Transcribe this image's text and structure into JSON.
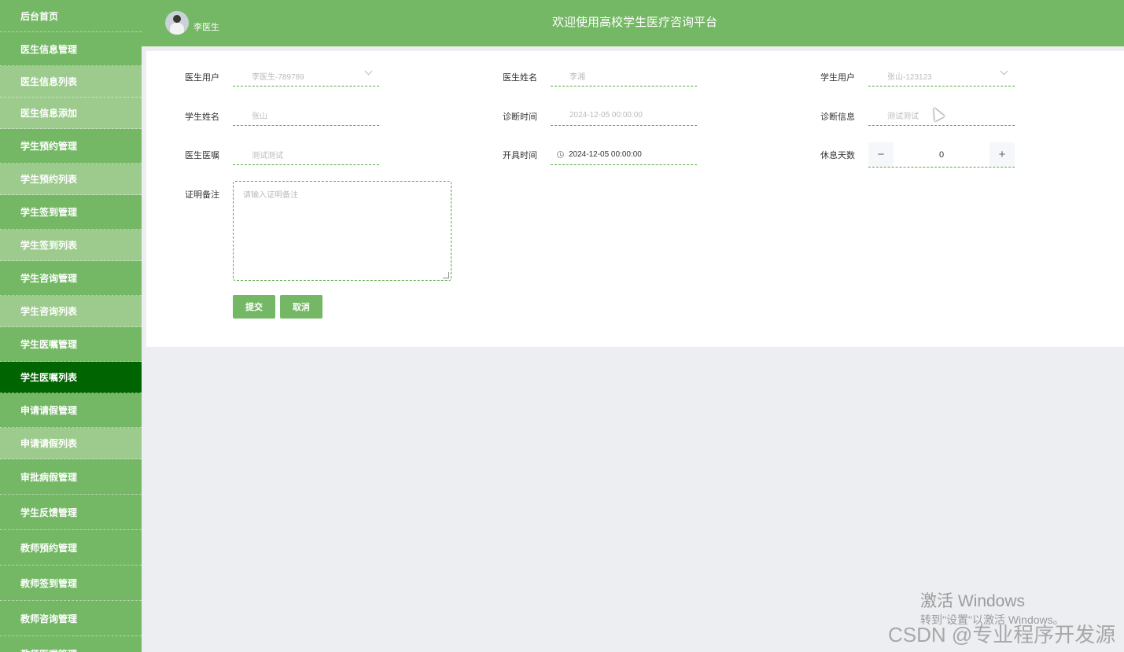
{
  "header": {
    "user_name": "李医生",
    "site_title": "欢迎使用高校学生医疗咨询平台"
  },
  "sidebar": {
    "items": [
      {
        "label": "后台首页",
        "type": "group"
      },
      {
        "label": "医生信息管理",
        "type": "group"
      },
      {
        "label": "医生信息列表",
        "type": "sub"
      },
      {
        "label": "医生信息添加",
        "type": "sub"
      },
      {
        "label": "学生预约管理",
        "type": "group"
      },
      {
        "label": "学生预约列表",
        "type": "sub"
      },
      {
        "label": "学生签到管理",
        "type": "group"
      },
      {
        "label": "学生签到列表",
        "type": "sub"
      },
      {
        "label": "学生咨询管理",
        "type": "group"
      },
      {
        "label": "学生咨询列表",
        "type": "sub"
      },
      {
        "label": "学生医嘱管理",
        "type": "group"
      },
      {
        "label": "学生医嘱列表",
        "type": "active"
      },
      {
        "label": "申请请假管理",
        "type": "group"
      },
      {
        "label": "申请请假列表",
        "type": "sub"
      },
      {
        "label": "审批病假管理",
        "type": "group"
      },
      {
        "label": "学生反馈管理",
        "type": "group"
      },
      {
        "label": "教师预约管理",
        "type": "group"
      },
      {
        "label": "教师签到管理",
        "type": "group"
      },
      {
        "label": "教师咨询管理",
        "type": "group"
      },
      {
        "label": "教师医嘱管理",
        "type": "group"
      }
    ]
  },
  "form": {
    "doctor_user": {
      "label": "医生用户",
      "value": "李医生-789789"
    },
    "doctor_name": {
      "label": "医生姓名",
      "value": "李湘"
    },
    "student_user": {
      "label": "学生用户",
      "value": "张山-123123"
    },
    "student_name": {
      "label": "学生姓名",
      "value": "张山"
    },
    "diagnosis_time": {
      "label": "诊断时间",
      "value": "2024-12-05 00:00:00"
    },
    "diagnosis_info": {
      "label": "诊断信息",
      "value": "测试测试"
    },
    "doctor_advice": {
      "label": "医生医嘱",
      "value": "测试测试"
    },
    "issue_time": {
      "label": "开具时间",
      "value": "2024-12-05 00:00:00"
    },
    "rest_days": {
      "label": "休息天数",
      "value": "0"
    },
    "certificate_note": {
      "label": "证明备注",
      "placeholder": "请输入证明备注"
    },
    "submit_label": "提交",
    "cancel_label": "取消"
  },
  "watermark": {
    "line1": "激活 Windows",
    "line2": "转到\"设置\"以激活 Windows。",
    "csdn": "CSDN @专业程序开发源"
  },
  "colors": {
    "primary": "#74b865",
    "sidebar_sub": "#9ccb8d",
    "sidebar_active": "#006400",
    "page_bg": "#edeef2"
  }
}
